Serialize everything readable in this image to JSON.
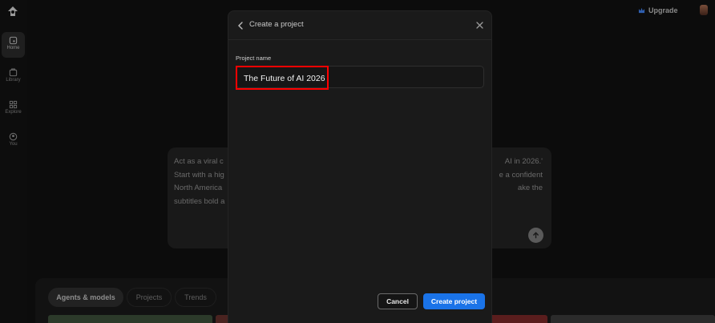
{
  "sidebar": {
    "items": [
      {
        "label": "Home",
        "icon": "home-icon",
        "active": true
      },
      {
        "label": "Library",
        "icon": "library-icon",
        "active": false
      },
      {
        "label": "Explore",
        "icon": "explore-icon",
        "active": false
      },
      {
        "label": "You",
        "icon": "user-icon",
        "active": false
      }
    ]
  },
  "header": {
    "upgrade_label": "Upgrade",
    "upgrade_icon": "crown-icon"
  },
  "prompt": {
    "lines": [
      "Act as a viral c",
      "Start with a hig",
      "North America",
      "subtitles bold a"
    ],
    "right_lines": [
      "AI in 2026.'",
      "e a confident",
      "ake the"
    ]
  },
  "tabs": [
    "Agents & models",
    "Projects",
    "Trends"
  ],
  "modal": {
    "title": "Create a project",
    "field_label": "Project name",
    "field_value": "The Future of AI 2026",
    "cancel_label": "Cancel",
    "create_label": "Create project"
  },
  "colors": {
    "accent": "#1a73e8",
    "highlight": "#ff0000",
    "background": "#0c0c0c",
    "modal": "#1a1a1a"
  }
}
